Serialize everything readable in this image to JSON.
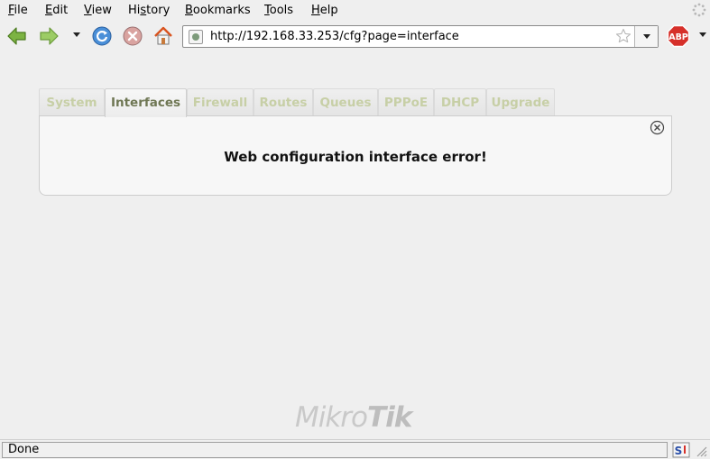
{
  "menubar": {
    "items": [
      {
        "mnemonic": "F",
        "rest": "ile"
      },
      {
        "mnemonic": "E",
        "rest": "dit"
      },
      {
        "mnemonic": "V",
        "rest": "iew"
      },
      {
        "pre": "Hi",
        "mnemonic": "s",
        "rest": "tory"
      },
      {
        "mnemonic": "B",
        "rest": "ookmarks"
      },
      {
        "mnemonic": "T",
        "rest": "ools"
      },
      {
        "mnemonic": "H",
        "rest": "elp"
      }
    ]
  },
  "toolbar": {
    "icons": [
      "back-arrow-icon",
      "forward-arrow-icon",
      "history-dropdown-icon",
      "reload-icon",
      "stop-icon",
      "home-icon",
      "adblock-plus-icon"
    ]
  },
  "address_bar": {
    "url": "http://192.168.33.253/cfg?page=interface"
  },
  "tabs": [
    {
      "label": "System",
      "active": false
    },
    {
      "label": "Interfaces",
      "active": true
    },
    {
      "label": "Firewall",
      "active": false
    },
    {
      "label": "Routes",
      "active": false
    },
    {
      "label": "Queues",
      "active": false
    },
    {
      "label": "PPPoE",
      "active": false
    },
    {
      "label": "DHCP",
      "active": false
    },
    {
      "label": "Upgrade",
      "active": false
    }
  ],
  "panel": {
    "error_message": "Web configuration interface error!"
  },
  "brand": {
    "part1": "Mikro",
    "part2": "Tik"
  },
  "statusbar": {
    "text": "Done"
  },
  "colors": {
    "tab_inactive": "#c7cfa6",
    "tab_active": "#6f7754",
    "background": "#efefef"
  }
}
